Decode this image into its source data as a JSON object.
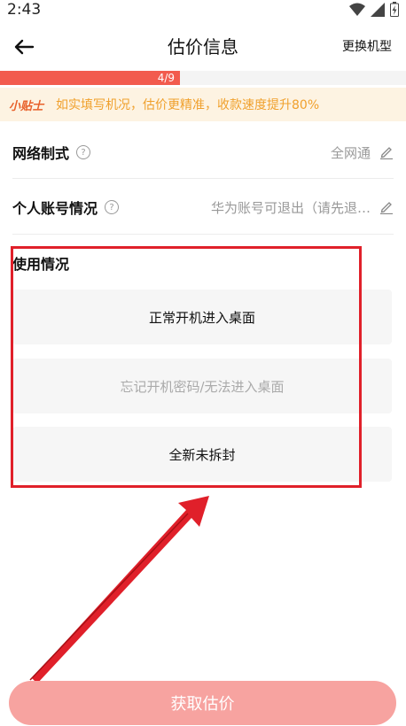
{
  "status_bar": {
    "time": "2:43"
  },
  "header": {
    "title": "估价信息",
    "switch_label": "更换机型"
  },
  "progress": {
    "label": "4/9",
    "fraction": 0.444
  },
  "tip": {
    "badge": "小贴士",
    "text": "如实填写机况，估价更精准，收款速度提升80%"
  },
  "rows": [
    {
      "label": "网络制式",
      "value": "全网通"
    },
    {
      "label": "个人账号情况",
      "value": "华为账号可退出（请先退…"
    }
  ],
  "usage": {
    "title": "使用情况",
    "options": [
      {
        "label": "正常开机进入桌面"
      },
      {
        "label": "忘记开机密码/无法进入桌面"
      },
      {
        "label": "全新未拆封"
      }
    ]
  },
  "bottom_button": {
    "label": "获取估价"
  },
  "colors": {
    "accent": "#f25b4e",
    "annotation": "#e0202a",
    "button": "#f7a3a0"
  }
}
